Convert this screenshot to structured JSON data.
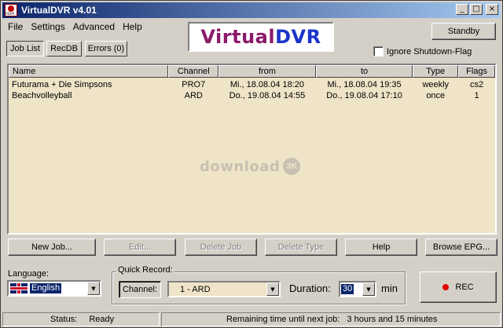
{
  "window": {
    "title": "VirtualDVR v4.01"
  },
  "title_buttons": {
    "minimize": "_",
    "maximize": "□",
    "close": "×"
  },
  "menu": [
    "File",
    "Settings",
    "Advanced",
    "Help"
  ],
  "logo": {
    "part1": "Virtual",
    "part2": "DVR",
    "color1": "#8b1a6b",
    "color2": "#1c35c9"
  },
  "standby_label": "Standby",
  "ignore_shutdown_label": "Ignore Shutdown-Flag",
  "ignore_shutdown_checked": false,
  "tabs": [
    "Job List",
    "RecDB",
    "Errors (0)"
  ],
  "active_tab": "Job List",
  "columns": [
    "Name",
    "Channel",
    "from",
    "to",
    "Type",
    "Flags"
  ],
  "jobs": [
    {
      "name": "Futurama + Die Simpsons",
      "channel": "PRO7",
      "from": "Mi., 18.08.04  18:20",
      "to": "Mi., 18.08.04  19:35",
      "type": "weekly",
      "flags": "cs2"
    },
    {
      "name": "Beachvolleyball",
      "channel": "ARD",
      "from": "Do., 19.08.04  14:55",
      "to": "Do., 19.08.04  17:10",
      "type": "once",
      "flags": "1"
    }
  ],
  "watermark": {
    "text": "download",
    "badge": "3K"
  },
  "buttons": {
    "new_job": "New Job...",
    "edit": "Edit...",
    "delete_job": "Delete Job",
    "delete_type": "Delete Type",
    "help": "Help",
    "browse_epg": "Browse EPG..."
  },
  "language": {
    "label": "Language:",
    "value": "English"
  },
  "quick_record": {
    "title": "Quick Record:",
    "channel_button": "Channel:",
    "channel_value": "1   -   ARD",
    "duration_label": "Duration:",
    "duration_value": "30",
    "duration_unit": "min"
  },
  "rec_label": "REC",
  "status": {
    "label": "Status:",
    "value": "Ready",
    "remaining": "Remaining time until next job:   3 hours and 15 minutes"
  },
  "icons": [
    "app-icon",
    "dropdown-arrow-icon",
    "flag-uk-icon",
    "record-dot-icon"
  ]
}
